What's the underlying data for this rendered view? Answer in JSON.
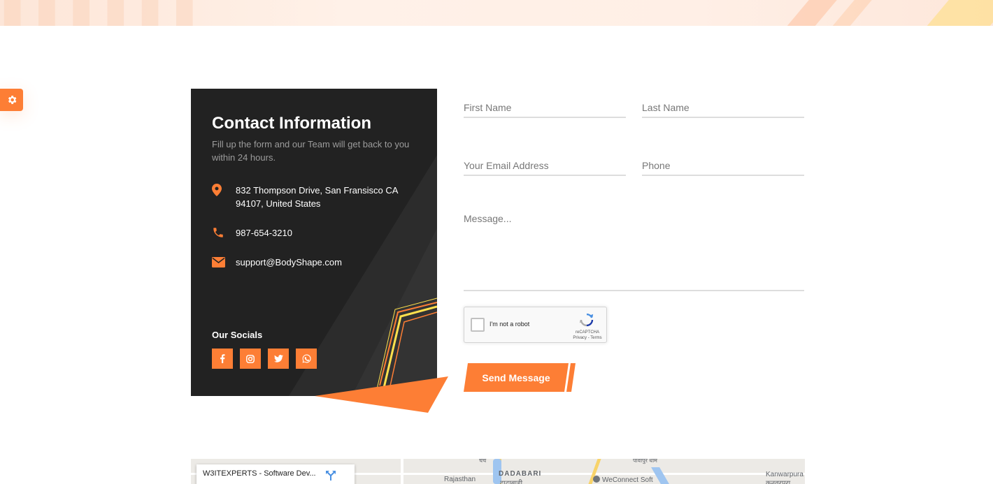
{
  "contact": {
    "title": "Contact Information",
    "subtitle": "Fill up the form and our Team will get back to you within 24 hours.",
    "address": "832 Thompson Drive, San Fransisco CA 94107, United States",
    "phone": "987-654-3210",
    "email": "support@BodyShape.com",
    "socials_title": "Our Socials",
    "socials": [
      {
        "icon": "facebook-icon"
      },
      {
        "icon": "instagram-icon"
      },
      {
        "icon": "twitter-icon"
      },
      {
        "icon": "whatsapp-icon"
      }
    ]
  },
  "form": {
    "first_name_placeholder": "First Name",
    "last_name_placeholder": "Last Name",
    "email_placeholder": "Your Email Address",
    "phone_placeholder": "Phone",
    "message_placeholder": "Message...",
    "recaptcha_label": "I'm not a robot",
    "recaptcha_brand": "reCAPTCHA",
    "recaptcha_links": "Privacy - Terms",
    "send_label": "Send Message"
  },
  "map": {
    "card_title": "W3ITEXPERTS - Software Dev...",
    "labels": [
      "Rajasthan",
      "DADABARI",
      "दादाबाड़ी",
      "WeConnect Soft",
      "Kanwarpura",
      "कनवरपुरा",
      "पावापुर धाम",
      "चर्च"
    ]
  },
  "colors": {
    "accent": "#fd7e35",
    "card_bg": "#222222",
    "highlight": "#ffe14d"
  }
}
